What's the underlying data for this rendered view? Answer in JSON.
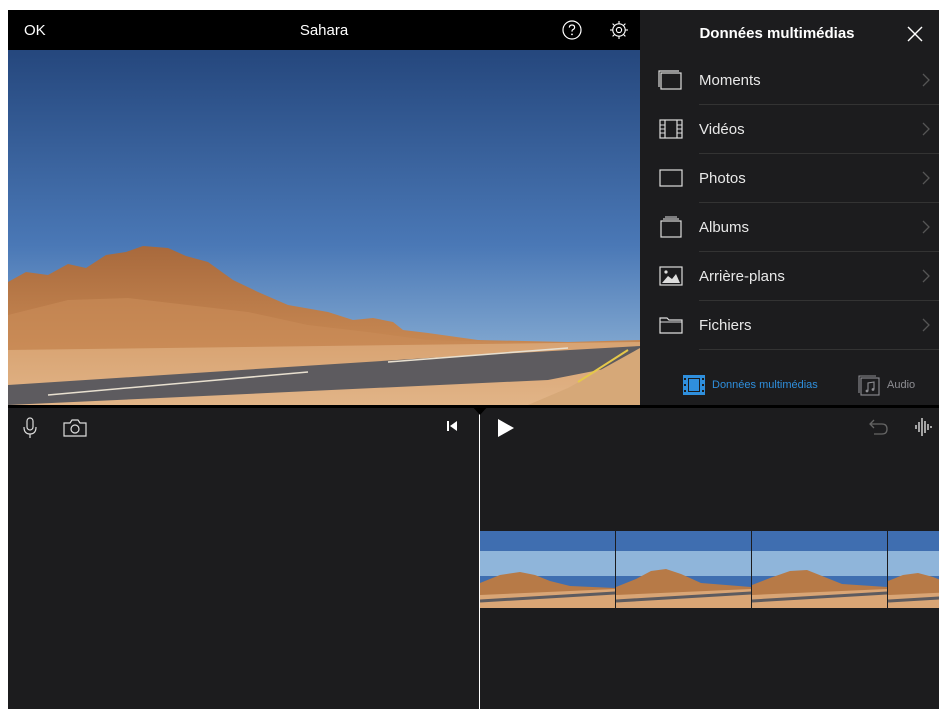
{
  "viewer": {
    "ok_label": "OK",
    "project_title": "Sahara"
  },
  "media_panel": {
    "title": "Données multimédias",
    "items": [
      {
        "label": "Moments",
        "icon": "moments-icon"
      },
      {
        "label": "Vidéos",
        "icon": "film-icon"
      },
      {
        "label": "Photos",
        "icon": "photo-frame-icon"
      },
      {
        "label": "Albums",
        "icon": "albums-icon"
      },
      {
        "label": "Arrière-plans",
        "icon": "backgrounds-icon"
      },
      {
        "label": "Fichiers",
        "icon": "folder-icon"
      }
    ],
    "tabs": [
      {
        "label": "Données multimédias",
        "icon": "media-tab-icon",
        "active": true
      },
      {
        "label": "Audio",
        "icon": "audio-tab-icon",
        "active": false
      }
    ]
  },
  "colors": {
    "accent": "#2f8fdd",
    "background": "#1c1c1e",
    "bar": "#000000",
    "separator": "#333333"
  }
}
